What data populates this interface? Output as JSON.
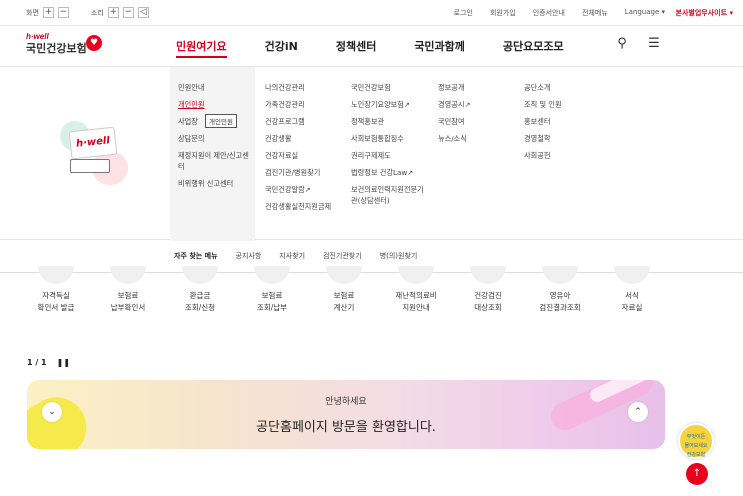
{
  "util": {
    "screen_label": "화면",
    "sound_label": "소리",
    "plus": "+",
    "minus": "−",
    "sound_icon": "◁",
    "links": [
      "로그인",
      "회원가입",
      "인증서안내",
      "전체메뉴",
      "Language ▾"
    ],
    "biz_site": "본사별업무사이트 ▾"
  },
  "logo": {
    "sub": "h·well",
    "main": "국민건강보험"
  },
  "gnb": [
    "민원여기요",
    "건강iN",
    "정책센터",
    "국민과함께",
    "공단요모조모"
  ],
  "header_icons": {
    "search": "⚲",
    "menu": "☰"
  },
  "mega": {
    "col1": [
      "민원안내",
      "개인민원",
      "사업장",
      "상담문의",
      "재정지원이 제안/신고센터",
      "비위행위 신고센터"
    ],
    "col2": [
      "나의건강관리",
      "가족건강관리",
      "건강프로그램",
      "건강생활",
      "건강자료실",
      "검진기관/병원찾기",
      "국민건강알람↗",
      "건강생활실천지원금제"
    ],
    "col3": [
      "국민건강보험",
      "노인장기요양보험↗",
      "정책홍보관",
      "사회보험통합징수",
      "권리구제제도",
      "법령정보 건강Law↗",
      "보건의료인력지원전문기관(상담센터)"
    ],
    "col4": [
      "정보공개",
      "경영공시↗",
      "국민참여",
      "뉴스/소식"
    ],
    "col5": [
      "공단소개",
      "조직 및 인원",
      "홍보센터",
      "경영철학",
      "사회공헌"
    ],
    "tooltip": "개인민원",
    "illus_text": "h·well"
  },
  "quick": [
    "자주 찾는 메뉴",
    "공지사항",
    "지사찾기",
    "검진기관찾기",
    "병(의)원찾기"
  ],
  "services": [
    [
      "자격득실",
      "확인서 발급"
    ],
    [
      "보험료",
      "납부확인서"
    ],
    [
      "환급금",
      "조회/신청"
    ],
    [
      "보험료",
      "조회/납부"
    ],
    [
      "보험료",
      "계산기"
    ],
    [
      "재난적의료비",
      "지원안내"
    ],
    [
      "건강검진",
      "대상조회"
    ],
    [
      "영유아",
      "검진결과조회"
    ],
    [
      "서식",
      "자료실"
    ]
  ],
  "pager": {
    "text": "1 / 1",
    "pause": "❚❚"
  },
  "banner": {
    "small": "안녕하세요",
    "big": "공단홈페이지 방문을 환영합니다.",
    "left_btn": "⌄",
    "right_btn": "⌃"
  },
  "chatbot": {
    "line1": "무엇이든",
    "line2": "물어보세요",
    "line3": "건강보험"
  },
  "totop": "↑"
}
